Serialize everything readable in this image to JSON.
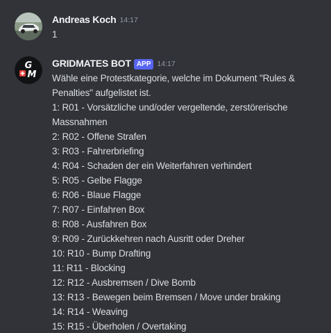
{
  "messages": [
    {
      "author": "Andreas Koch",
      "time": "14:17",
      "lines": [
        "1"
      ]
    },
    {
      "author": "GRIDMATES BOT",
      "badge": "APP",
      "time": "14:17",
      "intro": "Wähle eine Protestkategorie, welche im Dokument \"Rules & Penalties\" aufgelistet ist.",
      "items": [
        "1: R01 - Vorsätzliche und/oder vergeltende, zerstörerische Massnahmen",
        "2: R02 - Offene Strafen",
        "3: R03 - Fahrerbriefing",
        "4: R04 - Schaden der ein Weiterfahren verhindert",
        "5: R05 - Gelbe Flagge",
        "6: R06 - Blaue Flagge",
        "7: R07 - Einfahren Box",
        "8: R08 - Ausfahren Box",
        "9: R09 - Zurückkehren nach Ausritt oder Dreher",
        "10: R10 - Bump Drafting",
        "11: R11 - Blocking",
        "12: R12 - Ausbremsen / Dive Bomb",
        "13: R13 - Bewegen beim Bremsen / Move under braking",
        "14: R14 - Weaving",
        "15: R15 - Überholen / Overtaking"
      ],
      "avatar_letters": [
        "G",
        "M"
      ]
    }
  ],
  "colors": {
    "background": "#313338",
    "text": "#dbdee1",
    "username": "#f2f3f5",
    "timestamp": "#949ba4",
    "app_badge": "#5865f2",
    "bot_avatar_bg": "#111214",
    "bot_avatar_red": "#e53935"
  }
}
